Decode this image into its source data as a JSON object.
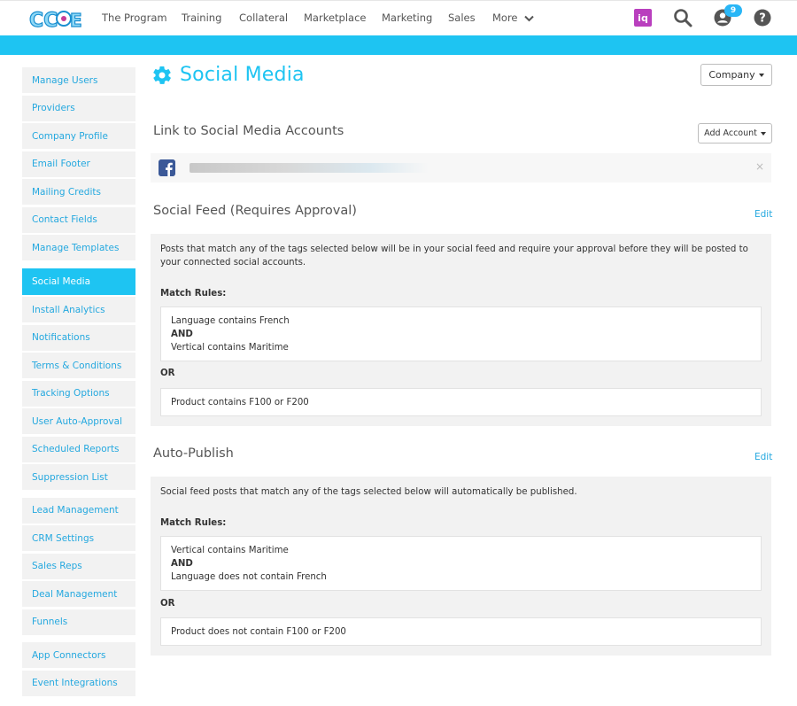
{
  "nav": {
    "logo_text": "CCDE",
    "items": [
      "The Program",
      "Training",
      "Collateral",
      "Marketplace",
      "Marketing",
      "Sales",
      "More"
    ],
    "iq_label": "iq",
    "notification_count": "9"
  },
  "sidebar": {
    "group1": [
      "Manage Users",
      "Providers",
      "Company Profile",
      "Email Footer",
      "Mailing Credits",
      "Contact Fields",
      "Manage Templates"
    ],
    "active": "Social Media",
    "group2": [
      "Install Analytics",
      "Notifications",
      "Terms & Conditions",
      "Tracking Options",
      "User Auto-Approval",
      "Scheduled Reports",
      "Suppression List"
    ],
    "group3": [
      "Lead Management",
      "CRM Settings",
      "Sales Reps",
      "Deal Management",
      "Funnels"
    ],
    "group4": [
      "App Connectors",
      "Event Integrations"
    ]
  },
  "page": {
    "title": "Social Media",
    "company_button": "Company"
  },
  "accounts": {
    "title": "Link to Social Media Accounts",
    "add_button": "Add Account",
    "remove_label": "×"
  },
  "social_feed": {
    "title": "Social Feed (Requires Approval)",
    "edit_label": "Edit",
    "description": "Posts that match any of the tags selected below will be in your social feed and require your approval before they will be posted to your connected social accounts.",
    "match_label": "Match Rules:",
    "rule1": [
      "Language contains French",
      "AND",
      "Vertical contains Maritime"
    ],
    "or_label": "OR",
    "rule2": "Product contains F100 or F200"
  },
  "auto_publish": {
    "title": "Auto-Publish",
    "edit_label": "Edit",
    "description": "Social feed posts that match any of the tags selected below will automatically be published.",
    "match_label": "Match Rules:",
    "rule1": [
      "Vertical contains Maritime",
      "AND",
      "Language does not contain French"
    ],
    "or_label": "OR",
    "rule2": "Product does not contain F100 or F200"
  },
  "colors": {
    "accent": "#1ec4f2",
    "link": "#24a8df",
    "iq": "#b93fbe",
    "facebook": "#3b5998"
  }
}
